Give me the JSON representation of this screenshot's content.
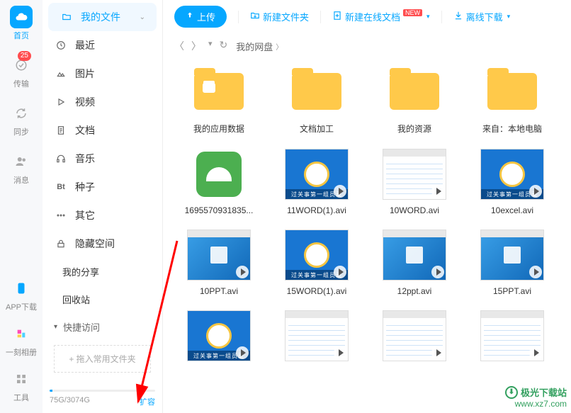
{
  "rail": {
    "items": [
      {
        "label": "首页",
        "icon": "cloud"
      },
      {
        "label": "传输",
        "icon": "transfer",
        "badge": "25"
      },
      {
        "label": "同步",
        "icon": "sync"
      },
      {
        "label": "消息",
        "icon": "people"
      }
    ],
    "bottom": [
      {
        "label": "APP下载",
        "icon": "phone"
      },
      {
        "label": "一刻相册",
        "icon": "album"
      },
      {
        "label": "工具",
        "icon": "tools"
      }
    ]
  },
  "sidebar": {
    "categories": [
      {
        "label": "我的文件",
        "icon": "folder",
        "active": true,
        "expandable": true
      },
      {
        "label": "最近",
        "icon": "clock"
      },
      {
        "label": "图片",
        "icon": "image"
      },
      {
        "label": "视频",
        "icon": "play"
      },
      {
        "label": "文档",
        "icon": "doc"
      },
      {
        "label": "音乐",
        "icon": "headphone"
      },
      {
        "label": "种子",
        "icon": "bt",
        "textIcon": "Bt"
      },
      {
        "label": "其它",
        "icon": "other"
      },
      {
        "label": "隐藏空间",
        "icon": "lock"
      }
    ],
    "sub": [
      "我的分享",
      "回收站"
    ],
    "quickAccess": {
      "label": "快捷访问",
      "placeholder": "+ 拖入常用文件夹"
    },
    "storage": {
      "text": "75G/3074G",
      "link": "扩容"
    }
  },
  "toolbar": {
    "upload": "上传",
    "newFolder": "新建文件夹",
    "newDoc": "新建在线文档",
    "newTag": "NEW",
    "offline": "离线下载"
  },
  "breadcrumb": {
    "path": "我的网盘"
  },
  "files": [
    {
      "name": "我的应用数据",
      "type": "folder-apps"
    },
    {
      "name": "文档加工",
      "type": "folder"
    },
    {
      "name": "我的资源",
      "type": "folder"
    },
    {
      "name": "来自：本地电脑",
      "type": "folder"
    },
    {
      "name": "1695570931835...",
      "type": "apk"
    },
    {
      "name": "11WORD(1).avi",
      "type": "video-emblem"
    },
    {
      "name": "10WORD.avi",
      "type": "video-sheet"
    },
    {
      "name": "10excel.avi",
      "type": "video-emblem"
    },
    {
      "name": "10PPT.avi",
      "type": "video-desktop"
    },
    {
      "name": "15WORD(1).avi",
      "type": "video-emblem"
    },
    {
      "name": "12ppt.avi",
      "type": "video-desktop"
    },
    {
      "name": "15PPT.avi",
      "type": "video-desktop"
    },
    {
      "name": "",
      "type": "video-emblem"
    },
    {
      "name": "",
      "type": "video-sheet"
    },
    {
      "name": "",
      "type": "video-sheet"
    },
    {
      "name": "",
      "type": "video-sheet"
    }
  ],
  "watermark": {
    "line1": "极光下载站",
    "line2": "www.xz7.com"
  }
}
